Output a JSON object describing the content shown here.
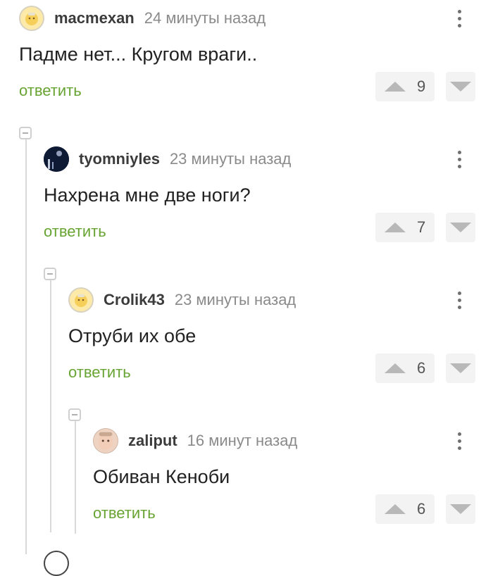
{
  "comments": [
    {
      "username": "macmexan",
      "time": "24 минуты назад",
      "text": "Падме нет... Кругом враги..",
      "reply_label": "ответить",
      "votes": "9",
      "avatar": "yellow-face-icon"
    },
    {
      "username": "tyomniyles",
      "time": "23 минуты назад",
      "text": "Нахрена мне две ноги?",
      "reply_label": "ответить",
      "votes": "7",
      "avatar": "night-photo-avatar"
    },
    {
      "username": "Crolik43",
      "time": "23 минуты назад",
      "text": "Отруби их обе",
      "reply_label": "ответить",
      "votes": "6",
      "avatar": "yellow-face-icon"
    },
    {
      "username": "zaliput",
      "time": "16 минут назад",
      "text": "Обиван Кеноби",
      "reply_label": "ответить",
      "votes": "6",
      "avatar": "child-photo-avatar"
    }
  ],
  "colors": {
    "reply": "#68a433",
    "username": "#3b3b3b",
    "time": "#8a8a8a",
    "thread_line": "#d9d9d9",
    "vote_bg": "#f3f3f3"
  }
}
